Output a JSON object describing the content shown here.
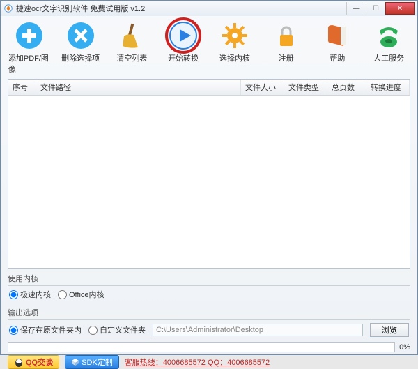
{
  "title": "捷速ocr文字识别软件 免费试用版 v1.2",
  "toolbar": [
    {
      "name": "add",
      "label": "添加PDF/图像"
    },
    {
      "name": "remove",
      "label": "删除选择项"
    },
    {
      "name": "clear",
      "label": "清空列表"
    },
    {
      "name": "start",
      "label": "开始转换"
    },
    {
      "name": "engine",
      "label": "选择内核"
    },
    {
      "name": "register",
      "label": "注册"
    },
    {
      "name": "help",
      "label": "帮助"
    },
    {
      "name": "service",
      "label": "人工服务"
    }
  ],
  "columns": {
    "seq": "序号",
    "path": "文件路径",
    "size": "文件大小",
    "type": "文件类型",
    "pages": "总页数",
    "prog": "转换进度"
  },
  "engine_section": {
    "hdr": "使用内核",
    "opt_fast": "极速内核",
    "opt_office": "Office内核"
  },
  "output_section": {
    "hdr": "输出选项",
    "opt_same": "保存在原文件夹内",
    "opt_custom": "自定义文件夹",
    "path": "C:\\Users\\Administrator\\Desktop",
    "browse": "浏览"
  },
  "progress_pct": "0%",
  "footer": {
    "qq": "QQ交谈",
    "sdk": "SDK定制",
    "hotline": "客服热线：4006685572 QQ：4006685572"
  }
}
